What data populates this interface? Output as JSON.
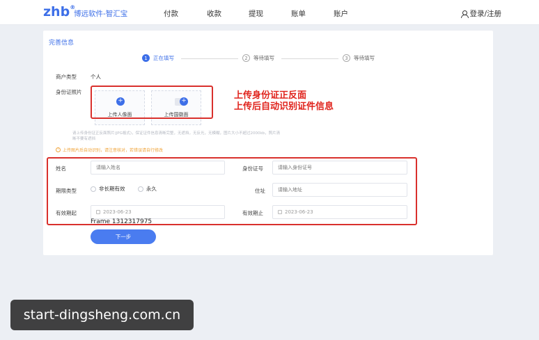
{
  "header": {
    "logo": "zhb",
    "brand": "博远软件-智汇宝",
    "nav": [
      "付款",
      "收款",
      "提现",
      "账单",
      "账户"
    ],
    "account_label": "登录/注册"
  },
  "card": {
    "title": "完善信息",
    "steps": [
      {
        "num": "1",
        "label": "正在填写"
      },
      {
        "num": "2",
        "label": "等待填写"
      },
      {
        "num": "3",
        "label": "等待填写"
      }
    ],
    "merchant_type_label": "商户类型",
    "merchant_type_value": "个人",
    "id_photo_label": "身份证照片",
    "upload_front": "上传人像面",
    "upload_back": "上传国徽面",
    "tip": "请上传身份证正反面照片(JPG格式)，保证证件信息清晰完整，无遮挡，无反光，无模糊，图片大小不超过2000kb，照片清晰不要有遮挡",
    "warning": "上传图片后自动识别，请注意核对，若错误请自行修改",
    "annotation_line1": "上传身份证正反面",
    "annotation_line2": "上传后自动识别证件信息",
    "form": {
      "name_label": "姓名",
      "name_placeholder": "请输入姓名",
      "id_label": "身份证号",
      "id_placeholder": "请输入身份证号",
      "period_type_label": "期限类型",
      "period_option_1": "非长期有效",
      "period_option_2": "永久",
      "address_label": "住址",
      "address_placeholder": "请输入地址",
      "start_label": "有效期起",
      "start_value": "2023-06-23",
      "end_label": "有效期止",
      "end_value": "2023-06-23"
    },
    "frame_label": "Frame 1312317975",
    "next_button": "下一步"
  },
  "watermark": "start-dingsheng.com.cn",
  "colors": {
    "accent": "#3d6fe8",
    "annotation_red": "#d9302c",
    "warning": "#f0a43a"
  }
}
